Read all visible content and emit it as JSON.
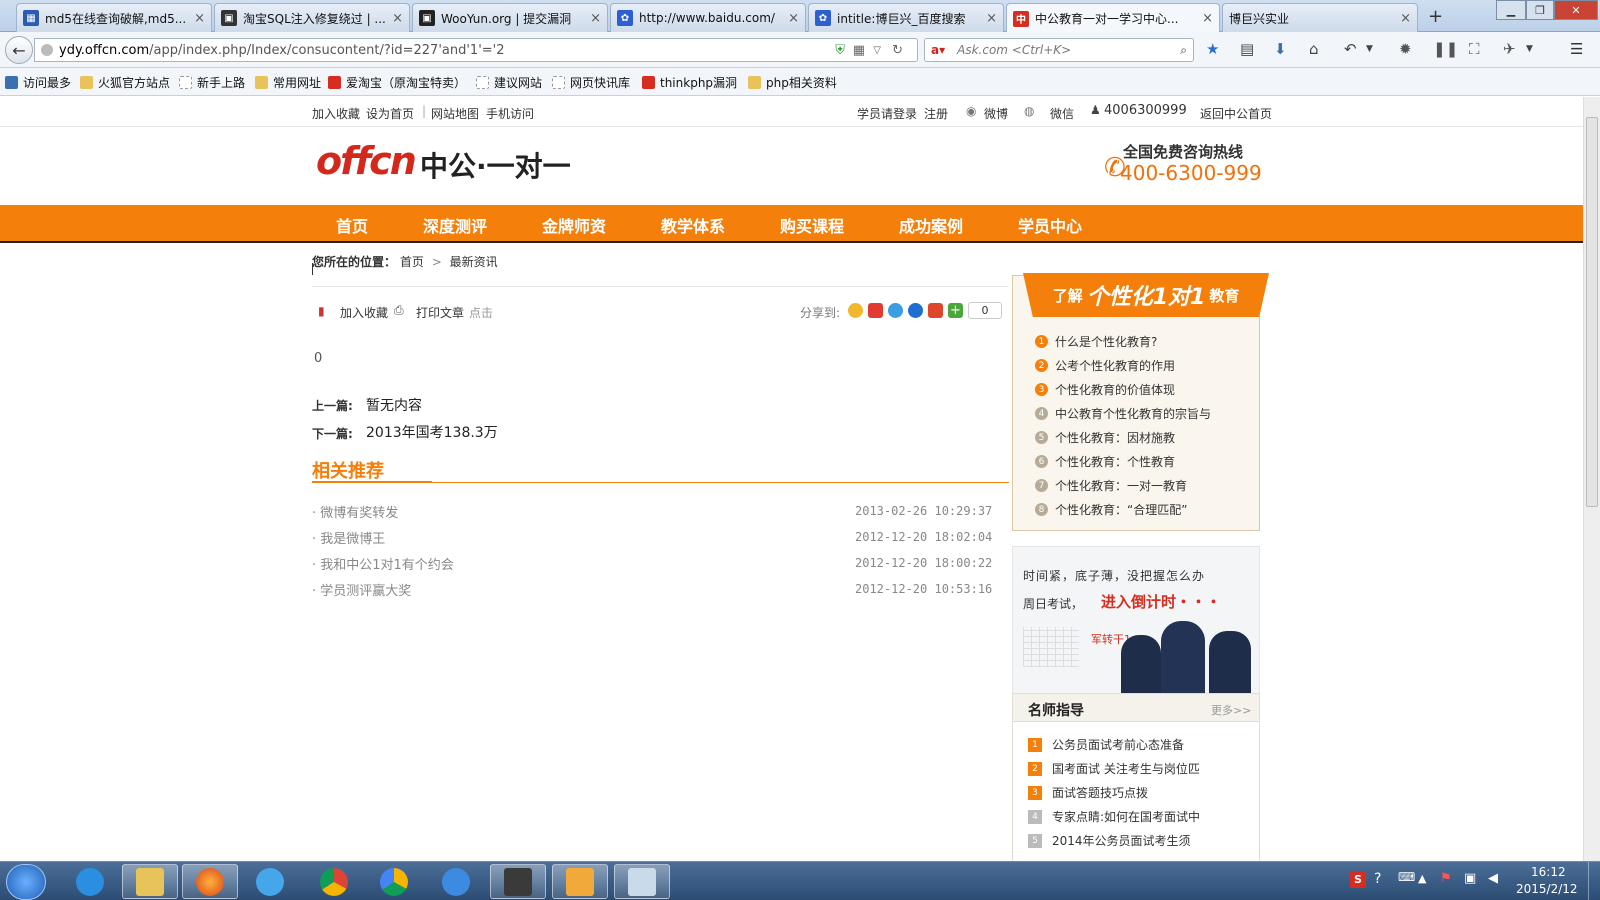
{
  "browser": {
    "tabs": [
      {
        "title": "md5在线查询破解,md5...",
        "icon_color": "#2a5db0",
        "active": false
      },
      {
        "title": "淘宝SQL注入修复绕过 | ...",
        "icon_color": "#333333",
        "active": false
      },
      {
        "title": "WooYun.org | 提交漏洞",
        "icon_color": "#222222",
        "active": false
      },
      {
        "title": "http://www.baidu.com/",
        "icon_color": "#2d5fd3",
        "active": false
      },
      {
        "title": "intitle:博巨兴_百度搜索",
        "icon_color": "#2d5fd3",
        "active": false
      },
      {
        "title": "中公教育一对一学习中心...",
        "icon_color": "#d62d20",
        "active": true
      },
      {
        "title": "博巨兴实业",
        "icon_color": "",
        "active": false
      }
    ],
    "new_tab": "+",
    "url_domain": "ydy.offcn.com",
    "url_path": "/app/index.php/Index/consucontent/?id=227'and'1'='2",
    "search_placeholder": "Ask.com <Ctrl+K>",
    "bookmarks": [
      {
        "label": "访问最多",
        "icon": "bookmark-icon",
        "color": "#3b6fb0"
      },
      {
        "label": "火狐官方站点",
        "icon": "folder-icon",
        "color": "#e8c35a"
      },
      {
        "label": "新手上路",
        "icon": "page-icon",
        "color": "#dddddd"
      },
      {
        "label": "常用网址",
        "icon": "folder-icon",
        "color": "#e8c35a"
      },
      {
        "label": "爱淘宝（原淘宝特卖）",
        "icon": "taobao-icon",
        "color": "#d62d20"
      },
      {
        "label": "建议网站",
        "icon": "page-icon",
        "color": "#dddddd"
      },
      {
        "label": "网页快讯库",
        "icon": "page-icon",
        "color": "#dddddd"
      },
      {
        "label": "thinkphp漏洞",
        "icon": "site-icon",
        "color": "#d62d20"
      },
      {
        "label": "php相关资料",
        "icon": "folder-icon",
        "color": "#e8c35a"
      }
    ]
  },
  "site": {
    "topbar": {
      "add_fav": "加入收藏",
      "set_home": "设为首页",
      "sep": "|",
      "sitemap": "网站地图",
      "mobile": "手机访问",
      "login": "学员请登录",
      "register": "注册",
      "weibo": "微博",
      "weixin": "微信",
      "qq": "4006300999",
      "back_home": "返回中公首页"
    },
    "logo_en": "offcn",
    "logo_cn": "中公·一对一",
    "hotline_label": "全国免费咨询热线",
    "hotline_number": "400-6300-999",
    "nav": [
      "首页",
      "深度测评",
      "金牌师资",
      "教学体系",
      "购买课程",
      "成功案例",
      "学员中心"
    ],
    "accent": "#f47f0b"
  },
  "article": {
    "breadcrumb_label": "您所在的位置：",
    "breadcrumb": [
      "首页",
      "最新资讯"
    ],
    "breadcrumb_sep": ">",
    "tools": {
      "fav": "加入收藏",
      "print": "打印文章",
      "click": "点击"
    },
    "share_label": "分享到:",
    "share_count": "0",
    "body": "0",
    "prev_label": "上一篇:",
    "prev_value": "暂无内容",
    "next_label": "下一篇:",
    "next_value": "2013年国考138.3万",
    "related_title": "相关推荐",
    "related": [
      {
        "title": "· 微博有奖转发",
        "date": "2013-02-26 10:29:37"
      },
      {
        "title": "· 我是微博王",
        "date": "2012-12-20 18:02:04"
      },
      {
        "title": "· 我和中公1对1有个约会",
        "date": "2012-12-20 18:00:22"
      },
      {
        "title": "· 学员测评赢大奖",
        "date": "2012-12-20 10:53:16"
      }
    ]
  },
  "sidebar": {
    "promo_pre": "了解",
    "promo_main": "个性化1对1",
    "promo_post": "教育",
    "items": [
      "什么是个性化教育?",
      "公考个性化教育的作用",
      "个性化教育的价值体现",
      "中公教育个性化教育的宗旨与",
      "个性化教育：因材施教",
      "个性化教育：个性教育",
      "个性化教育：一对一教育",
      "个性化教育：“合理匹配”"
    ],
    "numbers": [
      "1",
      "2",
      "3",
      "4",
      "5",
      "6",
      "7",
      "8"
    ],
    "ad_line1": "时间紧，底子薄，没把握怎么办",
    "ad_line2_pre": "周日考试，",
    "ad_line2_em": "进入倒计时・・・",
    "ad_tag": "军转干1",
    "teacher_title": "名师指导",
    "teacher_more": "更多>>",
    "teacher_items": [
      "公务员面试考前心态准备",
      "国考面试 关注考生与岗位匹",
      "面试答题技巧点拨",
      "专家点睛:如何在国考面试中",
      "2014年公务员面试考生须"
    ],
    "teacher_numbers": [
      "1",
      "2",
      "3",
      "4",
      "5"
    ]
  },
  "taskbar": {
    "time": "16:12",
    "date": "2015/2/12"
  }
}
